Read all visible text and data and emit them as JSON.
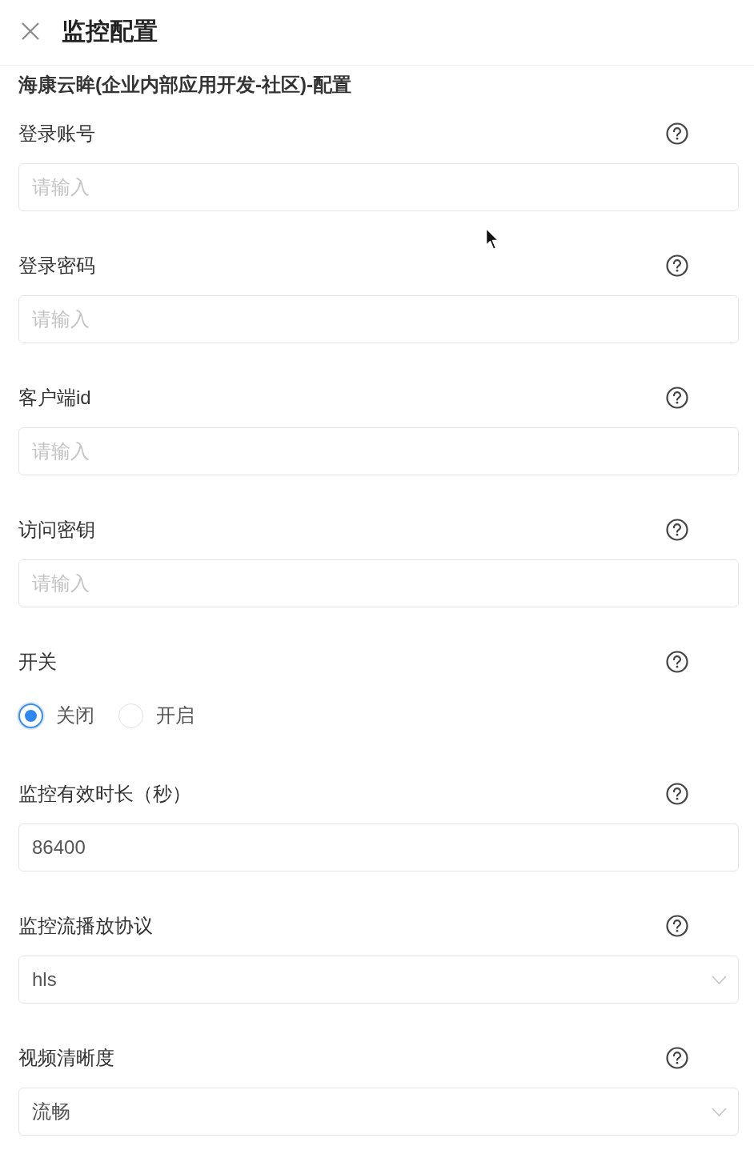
{
  "header": {
    "title": "监控配置"
  },
  "subtitle": "海康云眸(企业内部应用开发-社区)-配置",
  "fields": [
    {
      "kind": "text",
      "label": "登录账号",
      "placeholder": "请输入"
    },
    {
      "kind": "text",
      "label": "登录密码",
      "placeholder": "请输入"
    },
    {
      "kind": "text",
      "label": "客户端id",
      "placeholder": "请输入"
    },
    {
      "kind": "text",
      "label": "访问密钥",
      "placeholder": "请输入"
    },
    {
      "kind": "radio",
      "label": "开关",
      "options": [
        {
          "label": "关闭",
          "selected": true
        },
        {
          "label": "开启",
          "selected": false
        }
      ]
    },
    {
      "kind": "text",
      "label": "监控有效时长（秒）",
      "value": "86400"
    },
    {
      "kind": "select",
      "label": "监控流播放协议",
      "value": "hls"
    },
    {
      "kind": "select",
      "label": "视频清晰度",
      "value": "流畅"
    }
  ]
}
